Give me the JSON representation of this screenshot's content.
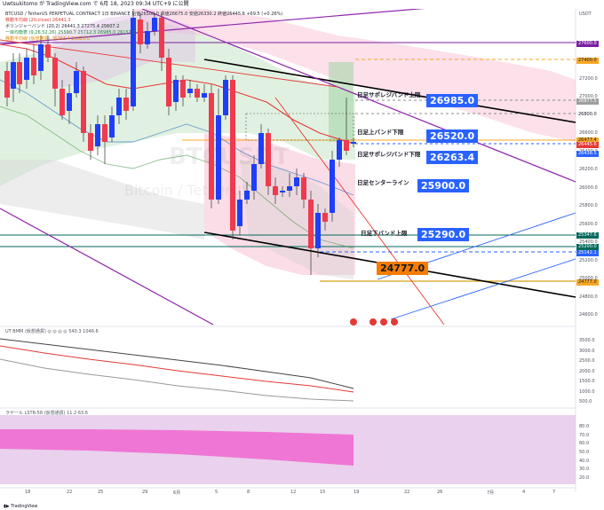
{
  "topbar": {
    "text": "Uwtsukitomo が TradingView.com で 6月 18, 2023 09:34 UTC+9 に公開"
  },
  "legend": [
    {
      "text": "BTCUSD / TetherUS PERPETUAL CONTRACT 1日 BINANCE  始値26500.0 高値26675.0 安値26330.2 終値26445.6 +69.5 (+0.26%)",
      "color": "default"
    },
    {
      "text": "移動平均線 (20,close)  26441.3",
      "color": "red"
    },
    {
      "text": "ボリンジャーバンド (20,2)  26441.3  27275.4  25607.2",
      "color": "default"
    },
    {
      "text": "一目均衡表 (9,26,52,26)  25590.7  25712.3  26985.0  26157.5",
      "color": "green"
    },
    {
      "text": "移動平均線 (仮想通貨)  26263.4  26520.0",
      "color": "orange"
    }
  ],
  "price_axis": {
    "labels": [
      "27400.0",
      "27200.0",
      "27000.0",
      "26800.0",
      "26600.0",
      "26400.0",
      "26200.0",
      "26000.0",
      "25800.0",
      "25600.0",
      "25400.0",
      "25200.0",
      "25000.0",
      "24800.0",
      "24600.0"
    ],
    "top_label": "USDT",
    "tags": [
      {
        "text": "27600.0",
        "color": "#7b1fa2"
      },
      {
        "text": "27400.0",
        "color": "#f9a825"
      },
      {
        "text": "26877.5",
        "color": "#9e9e9e"
      },
      {
        "text": "26800.0",
        "color": "#ffffff"
      },
      {
        "text": "26477.4",
        "color": "#f9a825"
      },
      {
        "text": "26445.6",
        "color": "#e53935"
      },
      {
        "text": "26438.5",
        "color": "#2962ff"
      },
      {
        "text": "25347.6",
        "color": "#00695c"
      },
      {
        "text": "25200.0",
        "color": "#00695c"
      },
      {
        "text": "25142.1",
        "color": "#2962ff"
      },
      {
        "text": "24777.0",
        "color": "#f9a825"
      }
    ]
  },
  "annotations": [
    {
      "text": "日足サポレジバンド上限",
      "box": "26985.0",
      "box_color": "#2962ff"
    },
    {
      "text": "日足上バンド下限",
      "box": "26520.0",
      "box_color": "#2962ff"
    },
    {
      "text": "日足サポレジバンド下限",
      "box": "26263.4",
      "box_color": "#2962ff"
    },
    {
      "text": "日足センターライン",
      "box": "25900.0",
      "box_color": "#2962ff"
    },
    {
      "text": "日足下バンド上限",
      "box": "25290.0",
      "box_color": "#2962ff"
    },
    {
      "text": "",
      "box": "24777.0",
      "box_color": "#f57c00"
    }
  ],
  "watermark": {
    "ticker": "BTCUSDT",
    "name": "Bitcoin / TetherUS"
  },
  "indicator1": {
    "title": "UT BMM (仮想通貨) ◎ ◎ ◎ ◎  540.3  1046.6",
    "axis": [
      "3500.0",
      "3000.0",
      "2500.0",
      "2000.0",
      "1500.0",
      "1000.0",
      "500.0"
    ]
  },
  "indicator2": {
    "title": "ラゲール LSTR-58 (仮想通貨)  11.2  63.6",
    "axis": [
      "80.0",
      "70.0",
      "60.0",
      "50.0",
      "40.0",
      "30.0",
      "20.0"
    ]
  },
  "time_axis": [
    "18",
    "22",
    "25",
    "29",
    "6月",
    "5",
    "8",
    "12",
    "15",
    "19",
    "22",
    "26",
    "7月",
    "4",
    "7"
  ],
  "footer": {
    "brand": "TradingView"
  },
  "colors": {
    "bull": "#1e3ff7",
    "bear": "#ef3b4f",
    "ma_red": "#e53935",
    "trend_black": "#000000",
    "purple": "#9c27b0",
    "cloud_green": "#c8e6c9",
    "cloud_pink": "#f8bbd0",
    "laguerre_fill": "#f06bd0"
  }
}
